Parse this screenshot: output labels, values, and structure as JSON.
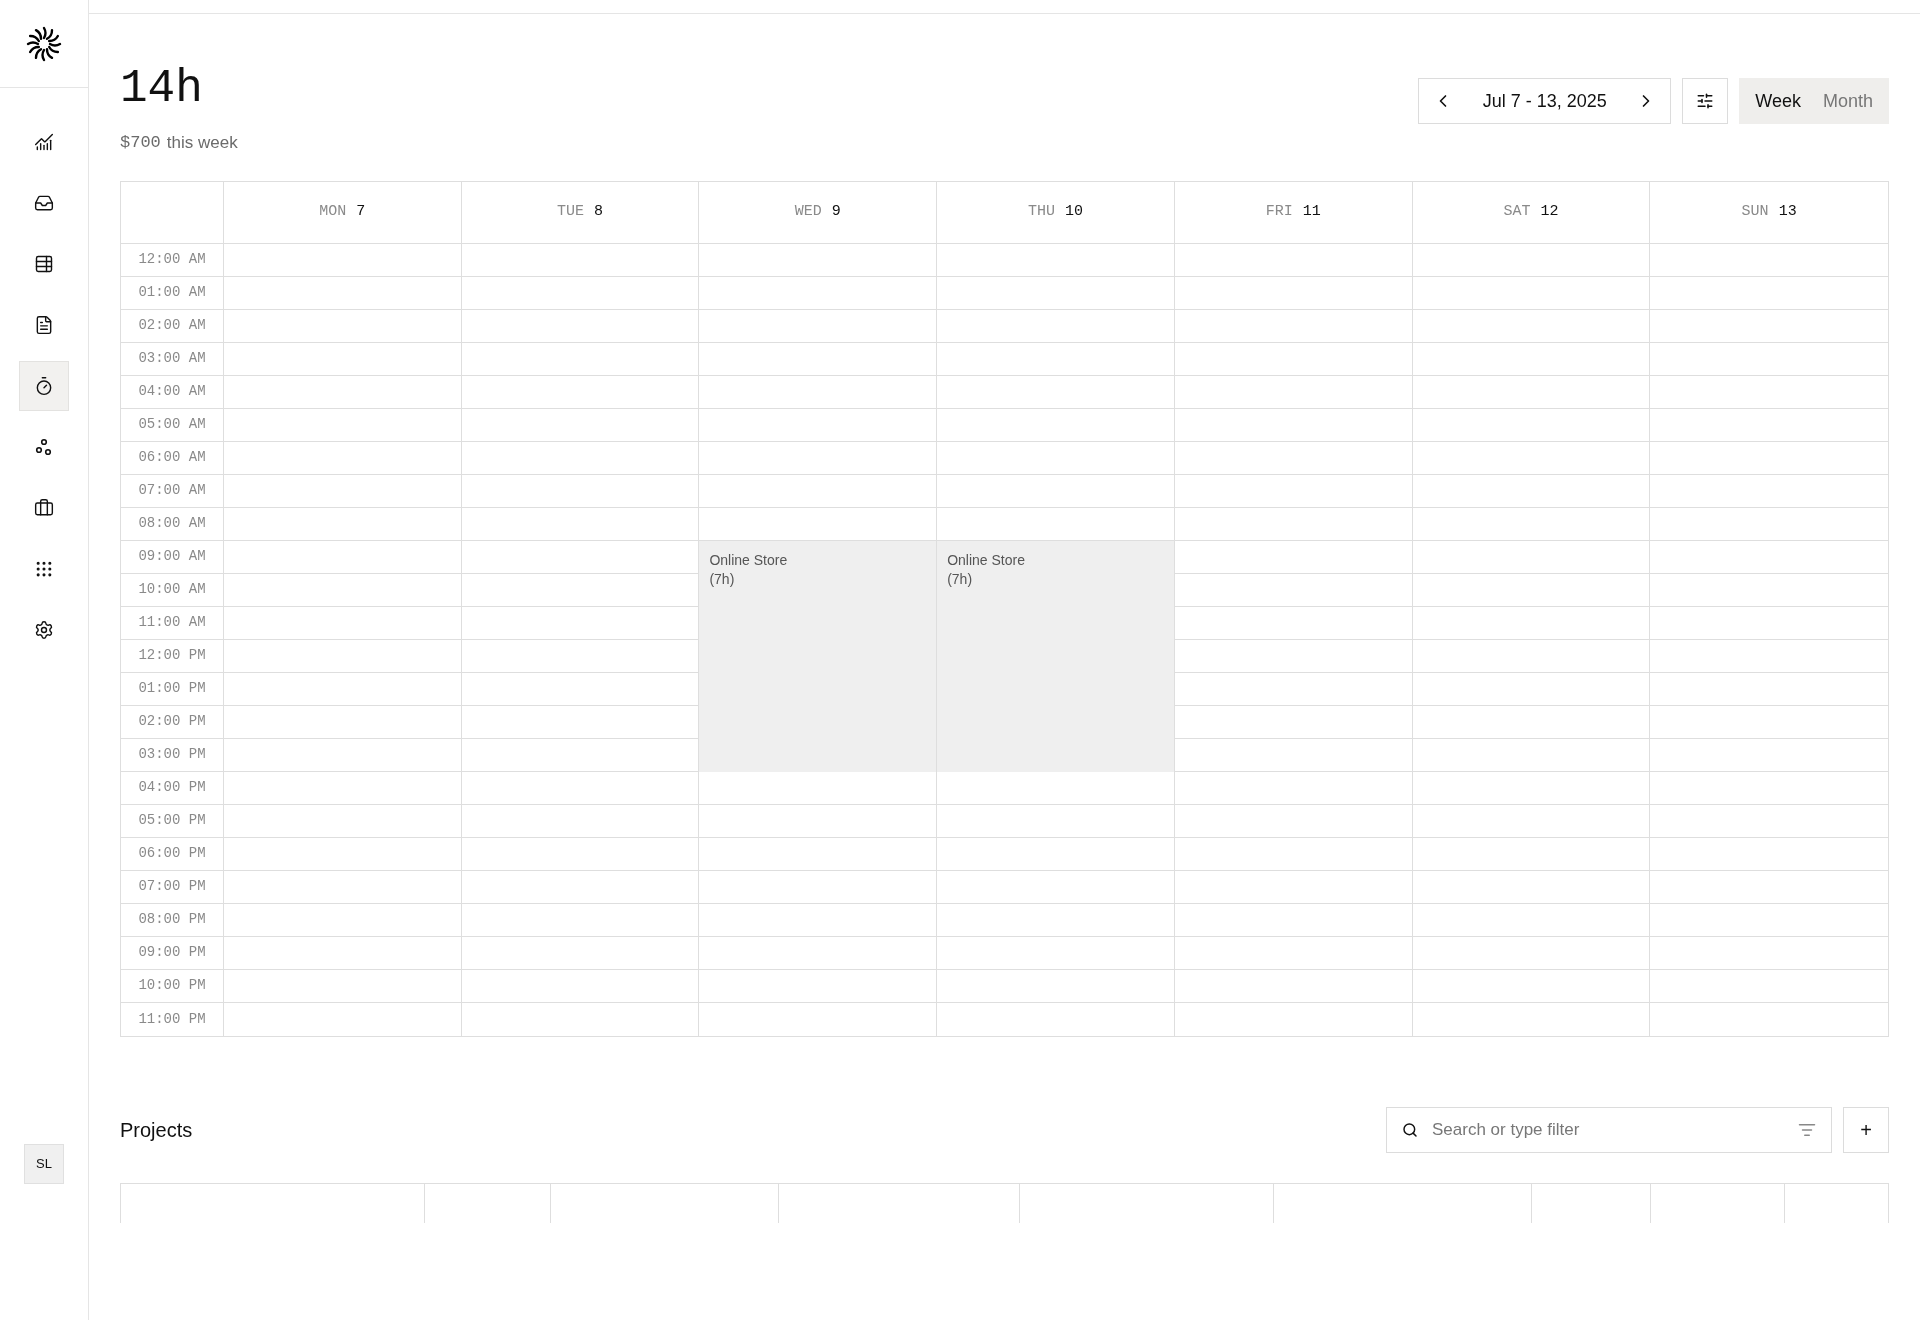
{
  "sidebar": {
    "items": [
      {
        "kind": "chart",
        "selected": false
      },
      {
        "kind": "inbox",
        "selected": false
      },
      {
        "kind": "list",
        "selected": false
      },
      {
        "kind": "document",
        "selected": false
      },
      {
        "kind": "timer",
        "selected": true
      },
      {
        "kind": "circles",
        "selected": false
      },
      {
        "kind": "briefcase",
        "selected": false
      },
      {
        "kind": "apps",
        "selected": false
      },
      {
        "kind": "settings",
        "selected": false
      }
    ],
    "avatar": "SL"
  },
  "summary": {
    "total": "14h",
    "amount": "$700",
    "amount_label": "this week"
  },
  "date_range": "Jul 7 - 13, 2025",
  "view_tabs": [
    {
      "label": "Week",
      "selected": true
    },
    {
      "label": "Month",
      "selected": false
    }
  ],
  "calendar": {
    "days": [
      {
        "name": "MON",
        "date": "7"
      },
      {
        "name": "TUE",
        "date": "8"
      },
      {
        "name": "WED",
        "date": "9"
      },
      {
        "name": "THU",
        "date": "10"
      },
      {
        "name": "FRI",
        "date": "11"
      },
      {
        "name": "SAT",
        "date": "12"
      },
      {
        "name": "SUN",
        "date": "13"
      }
    ],
    "hours": [
      "12:00 AM",
      "01:00 AM",
      "02:00 AM",
      "03:00 AM",
      "04:00 AM",
      "05:00 AM",
      "06:00 AM",
      "07:00 AM",
      "08:00 AM",
      "09:00 AM",
      "10:00 AM",
      "11:00 AM",
      "12:00 PM",
      "01:00 PM",
      "02:00 PM",
      "03:00 PM",
      "04:00 PM",
      "05:00 PM",
      "06:00 PM",
      "07:00 PM",
      "08:00 PM",
      "09:00 PM",
      "10:00 PM",
      "11:00 PM"
    ],
    "events": [
      {
        "title": "Online Store",
        "duration": "(7h)"
      },
      {
        "title": "Online Store",
        "duration": "(7h)"
      }
    ]
  },
  "projects": {
    "title": "Projects",
    "search": {
      "placeholder": "Search or type filter"
    },
    "add_button": "+"
  }
}
